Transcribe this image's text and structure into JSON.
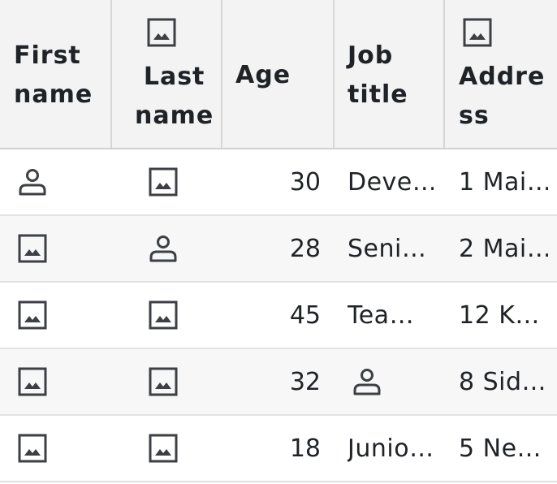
{
  "columns": [
    {
      "key": "first_name",
      "label": "First\nname",
      "header_icon": null
    },
    {
      "key": "last_name",
      "label": "Last\nname",
      "header_icon": "image-icon"
    },
    {
      "key": "age",
      "label": "Age",
      "header_icon": null
    },
    {
      "key": "job_title",
      "label": "Job\ntitle",
      "header_icon": null
    },
    {
      "key": "address",
      "label": "Addre\nss",
      "header_icon": "image-icon"
    }
  ],
  "rows": [
    {
      "first_name": "person-icon",
      "last_name": "image-icon",
      "age": "30",
      "job_title": "Deve…",
      "address": "1 Mai…"
    },
    {
      "first_name": "image-icon",
      "last_name": "person-icon",
      "age": "28",
      "job_title": "Seni…",
      "address": "2 Mai…"
    },
    {
      "first_name": "image-icon",
      "last_name": "image-icon",
      "age": "45",
      "job_title": "Tea…",
      "address": "12 K…"
    },
    {
      "first_name": "image-icon",
      "last_name": "image-icon",
      "age": "32",
      "job_title": "person-icon",
      "address": "8 Sid…"
    },
    {
      "first_name": "image-icon",
      "last_name": "image-icon",
      "age": "18",
      "job_title": "Junio…",
      "address": "5 Ne…"
    }
  ],
  "colors": {
    "header_bg": "#f3f3f3",
    "row_alt_bg": "#f6f7f6",
    "text": "#1f2226",
    "icon": "#3c3f44"
  }
}
